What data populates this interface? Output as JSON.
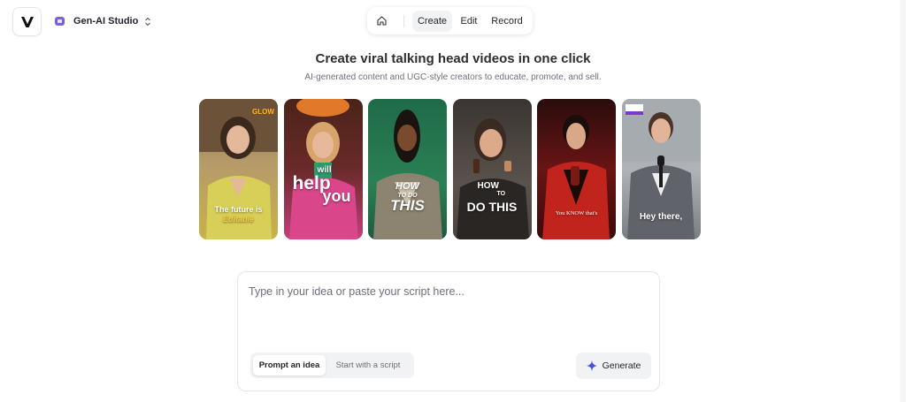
{
  "app": {
    "logo_letter": "V",
    "workspace": "Gen-AI Studio"
  },
  "nav": {
    "home_icon": "home-icon",
    "tabs": [
      {
        "label": "Create",
        "active": true
      },
      {
        "label": "Edit",
        "active": false
      },
      {
        "label": "Record",
        "active": false
      }
    ]
  },
  "hero": {
    "title": "Create viral talking head videos in one click",
    "subtitle": "AI-generated content and UGC-style creators to educate, promote, and sell."
  },
  "cards": [
    {
      "caption_1": "The future is",
      "caption_2": "Editable",
      "badge": "GLOW"
    },
    {
      "caption_1": "will",
      "caption_2": "help",
      "caption_3": "you"
    },
    {
      "caption_1": "HOW",
      "caption_2": "TO DO",
      "caption_3": "THIS"
    },
    {
      "caption_1": "HOW",
      "caption_2": "TO",
      "caption_3": "DO THIS"
    },
    {
      "caption_1": "You KNOW that's"
    },
    {
      "caption_1": "Hey there,"
    }
  ],
  "composer": {
    "placeholder": "Type in your idea or paste your script here...",
    "mode_active": "Prompt an idea",
    "mode_inactive": "Start with a script",
    "generate_label": "Generate"
  },
  "colors": {
    "accent": "#7b61d8",
    "generate_icon": "#4a4fe0"
  }
}
